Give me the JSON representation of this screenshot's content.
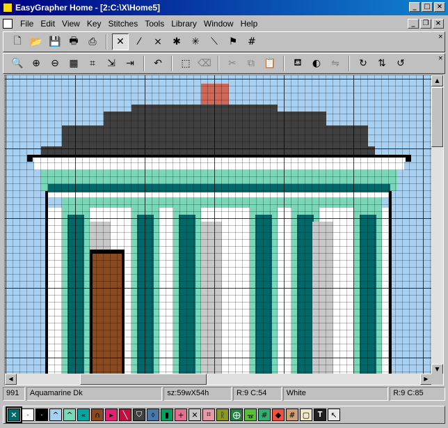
{
  "window": {
    "title": "EasyGrapher Home - [2:C:\\X\\Home5]"
  },
  "menu": [
    "File",
    "Edit",
    "View",
    "Key",
    "Stitches",
    "Tools",
    "Library",
    "Window",
    "Help"
  ],
  "toolbar1": [
    {
      "name": "new-file-icon",
      "glyph": "🗋"
    },
    {
      "name": "open-folder-icon",
      "glyph": "📂"
    },
    {
      "name": "save-disk-icon",
      "glyph": "💾"
    },
    {
      "name": "print-preview-icon",
      "glyph": "🖶"
    },
    {
      "name": "print-icon",
      "glyph": "⎙"
    },
    {
      "name": "full-cross-stitch-icon",
      "glyph": "✕",
      "pressed": true
    },
    {
      "name": "half-stitch-icon",
      "glyph": "⁄"
    },
    {
      "name": "quarter-stitch-icon",
      "glyph": "⨯"
    },
    {
      "name": "three-quarter-stitch-icon",
      "glyph": "✱"
    },
    {
      "name": "star-stitch-icon",
      "glyph": "✳"
    },
    {
      "name": "backstitch-icon",
      "glyph": "⟍"
    },
    {
      "name": "french-knot-icon",
      "glyph": "⚑"
    },
    {
      "name": "grid-icon",
      "glyph": "#"
    }
  ],
  "toolbar2": [
    {
      "name": "zoom-icon",
      "glyph": "🔍"
    },
    {
      "name": "zoom-in-icon",
      "glyph": "⊕"
    },
    {
      "name": "zoom-out-icon",
      "glyph": "⊖"
    },
    {
      "name": "view-chart-icon",
      "glyph": "▦"
    },
    {
      "name": "pattern-icon",
      "glyph": "⌗"
    },
    {
      "name": "export-icon",
      "glyph": "⇲"
    },
    {
      "name": "import-icon",
      "glyph": "⇥"
    },
    {
      "name": "undo-icon",
      "glyph": "↶"
    },
    {
      "name": "select-rect-icon",
      "glyph": "⬚"
    },
    {
      "name": "eraser-icon",
      "glyph": "⌫",
      "grey": true
    },
    {
      "name": "cut-icon",
      "glyph": "✂",
      "grey": true
    },
    {
      "name": "copy-icon",
      "glyph": "⧉",
      "grey": true
    },
    {
      "name": "paste-icon",
      "glyph": "📋",
      "grey": true
    },
    {
      "name": "fill-bucket-icon",
      "glyph": "⛾"
    },
    {
      "name": "color-picker-icon",
      "glyph": "◐"
    },
    {
      "name": "replace-color-icon",
      "glyph": "⇋",
      "grey": true
    },
    {
      "name": "rotate-cw-icon",
      "glyph": "↻"
    },
    {
      "name": "flip-icon",
      "glyph": "⇅"
    },
    {
      "name": "rotate-ccw-icon",
      "glyph": "↺"
    }
  ],
  "status": {
    "color_number": "991",
    "color_name": "Aquamarine Dk",
    "size": "sz:59wX54h",
    "position": "R:9 C:54",
    "hover_color": "White",
    "cursor": "R:9 C:85"
  },
  "colors": {
    "sky": "#a8d0f0",
    "roof": "#404040",
    "chimney": "#d06858",
    "white": "#ffffff",
    "aqua_light": "#78d8b8",
    "aqua_dark": "#006868",
    "grey": "#c8c8c8",
    "door": "#8a4a20",
    "black": "#000000"
  },
  "palette": [
    {
      "name": "swatch-aqua-dark",
      "color": "#006868",
      "glyph": "✕",
      "selected": true
    },
    {
      "name": "swatch-white",
      "color": "#ffffff",
      "glyph": "·"
    },
    {
      "name": "swatch-black",
      "color": "#000000",
      "glyph": "·"
    },
    {
      "name": "swatch-sky-blue",
      "color": "#a8d0f0",
      "glyph": "^"
    },
    {
      "name": "swatch-aqua-light",
      "color": "#78d8b8",
      "glyph": "^"
    },
    {
      "name": "swatch-teal",
      "color": "#00a8a0",
      "glyph": "«"
    },
    {
      "name": "swatch-brown",
      "color": "#8a4a20",
      "glyph": "∩"
    },
    {
      "name": "swatch-magenta",
      "color": "#e02070",
      "glyph": "▸"
    },
    {
      "name": "swatch-crimson",
      "color": "#c01040",
      "glyph": "╲"
    },
    {
      "name": "swatch-dark-grey",
      "color": "#404040",
      "glyph": "⛉"
    },
    {
      "name": "swatch-blue-grey",
      "color": "#4878a8",
      "glyph": "⬨"
    },
    {
      "name": "swatch-green",
      "color": "#00a060",
      "glyph": "▮"
    },
    {
      "name": "swatch-pink",
      "color": "#e07090",
      "glyph": "+"
    },
    {
      "name": "swatch-silver",
      "color": "#c8c8c8",
      "glyph": "✕"
    },
    {
      "name": "swatch-rose",
      "color": "#e898a8",
      "glyph": "⌗"
    },
    {
      "name": "swatch-olive",
      "color": "#889820",
      "glyph": "ᚱ"
    },
    {
      "name": "swatch-forest",
      "color": "#208040",
      "glyph": "⨁"
    },
    {
      "name": "swatch-lime",
      "color": "#58c038",
      "glyph": "ᚗ"
    },
    {
      "name": "swatch-sea",
      "color": "#30b070",
      "glyph": "#"
    },
    {
      "name": "swatch-coral",
      "color": "#f05040",
      "glyph": "◆"
    },
    {
      "name": "swatch-tan",
      "color": "#d0a070",
      "glyph": "#"
    },
    {
      "name": "swatch-cream",
      "color": "#f0e8c8",
      "glyph": "▢"
    },
    {
      "name": "swatch-charcoal",
      "color": "#202020",
      "glyph": "𝐓"
    },
    {
      "name": "swatch-pale-grey",
      "color": "#e8e8e8",
      "glyph": "↖"
    }
  ]
}
